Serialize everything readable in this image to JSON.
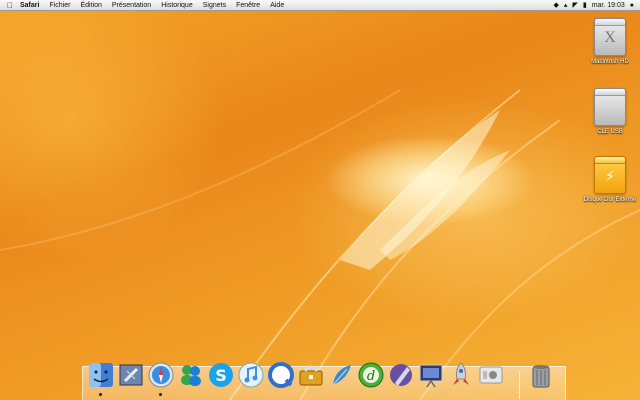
{
  "menubar": {
    "app_name": "Safari",
    "items": [
      "Fichier",
      "Édition",
      "Présentation",
      "Historique",
      "Signets",
      "Fenêtre",
      "Aide"
    ],
    "clock": "mar. 19:03"
  },
  "desktop_icons": [
    {
      "label": "Macintosh HD",
      "glyph": "X",
      "icon": "hard-drive-icon"
    },
    {
      "label": "CLE USB",
      "glyph": "",
      "icon": "usb-drive-icon"
    },
    {
      "label": "Disque Dur Externe",
      "glyph": "⚡",
      "icon": "external-drive-icon"
    }
  ],
  "dock": {
    "apps": [
      {
        "name": "finder",
        "icon": "finder-icon",
        "color": "#3f7fd6"
      },
      {
        "name": "mail",
        "icon": "mail-icon",
        "color": "#6b86b3"
      },
      {
        "name": "safari",
        "icon": "safari-icon",
        "color": "#3a8ee0"
      },
      {
        "name": "msn-messenger",
        "icon": "messenger-icon",
        "color": "#2fa84f"
      },
      {
        "name": "skype",
        "icon": "skype-icon",
        "color": "#1aa3e8"
      },
      {
        "name": "itunes",
        "icon": "itunes-icon",
        "color": "#3c8fe3"
      },
      {
        "name": "quicktime",
        "icon": "quicktime-icon",
        "color": "#2f6fd2"
      },
      {
        "name": "toolbox",
        "icon": "toolbox-icon",
        "color": "#e0a020"
      },
      {
        "name": "feather",
        "icon": "feather-icon",
        "color": "#3a88c8"
      },
      {
        "name": "dreamweaver",
        "icon": "dreamweaver-icon",
        "color": "#4caf3a"
      },
      {
        "name": "pen-app",
        "icon": "pen-icon",
        "color": "#6a4fa0"
      },
      {
        "name": "presentation",
        "icon": "presentation-icon",
        "color": "#333a66"
      },
      {
        "name": "rocket",
        "icon": "rocket-icon",
        "color": "#d0d0d0"
      },
      {
        "name": "apple-app",
        "icon": "apple-app-icon",
        "color": "#e8e8e8"
      },
      {
        "name": "trash",
        "icon": "trash-icon",
        "color": "#9aa0a6"
      }
    ]
  }
}
